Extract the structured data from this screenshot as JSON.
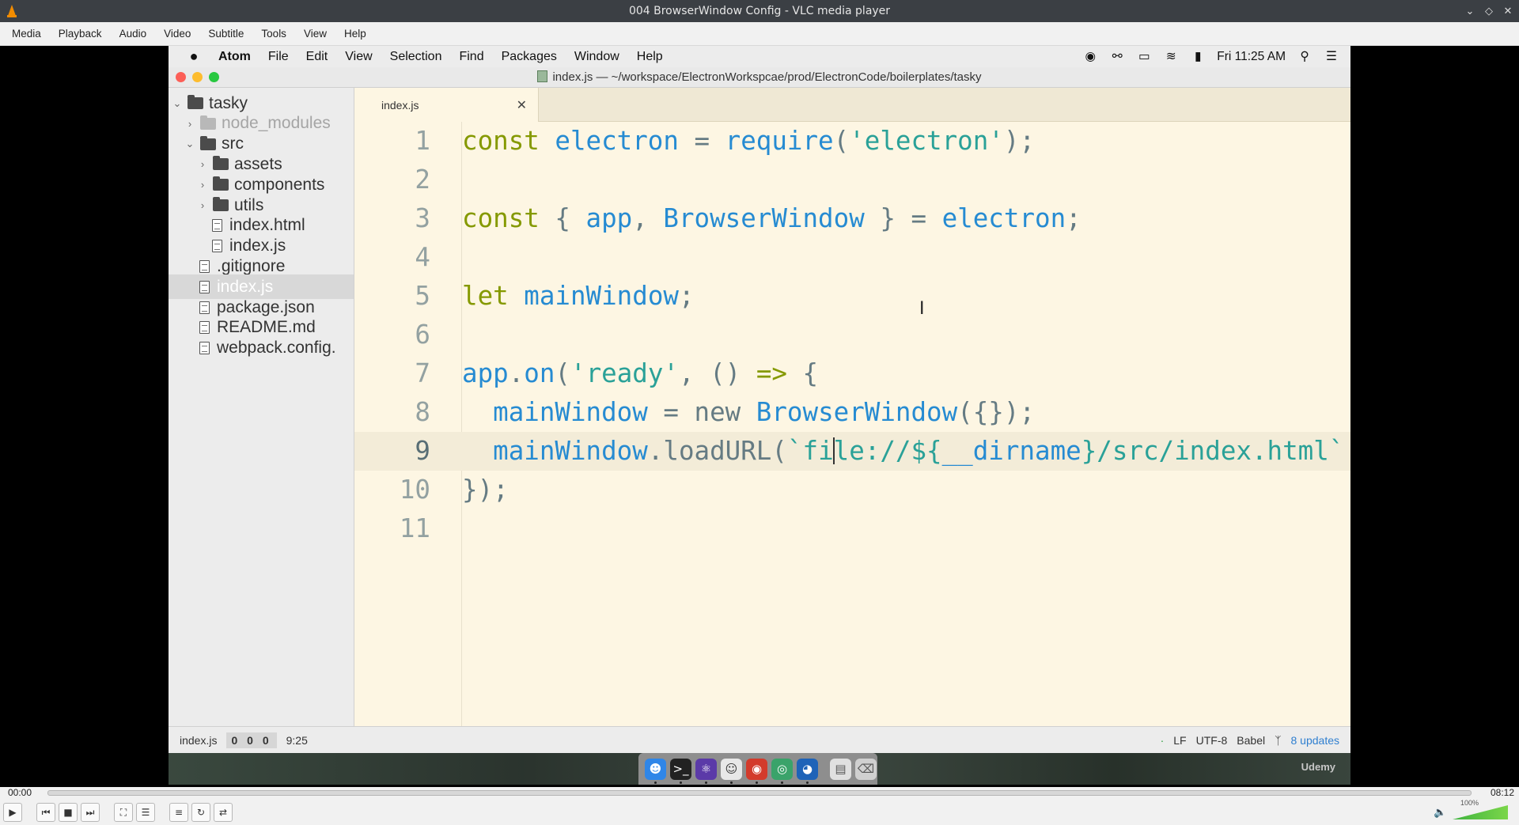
{
  "vlc": {
    "title": "004 BrowserWindow Config - VLC media player",
    "menu": [
      "Media",
      "Playback",
      "Audio",
      "Video",
      "Subtitle",
      "Tools",
      "View",
      "Help"
    ],
    "time_elapsed": "00:00",
    "time_total": "08:12",
    "volume": "100%",
    "progress": 0.0
  },
  "mac": {
    "app_name": "Atom",
    "menu": [
      "File",
      "Edit",
      "View",
      "Selection",
      "Find",
      "Packages",
      "Window",
      "Help"
    ],
    "clock": "Fri 11:25 AM"
  },
  "atom": {
    "title": "index.js — ~/workspace/ElectronWorkspcae/prod/ElectronCode/boilerplates/tasky",
    "tab_label": "index.js",
    "tree": [
      {
        "label": "tasky",
        "kind": "folder",
        "state": "open"
      },
      {
        "label": "node_modules",
        "kind": "folder",
        "state": "closed",
        "dim": true
      },
      {
        "label": "src",
        "kind": "folder",
        "state": "open"
      },
      {
        "label": "assets",
        "kind": "folder",
        "state": "closed"
      },
      {
        "label": "components",
        "kind": "folder",
        "state": "closed"
      },
      {
        "label": "utils",
        "kind": "folder",
        "state": "closed"
      },
      {
        "label": "index.html",
        "kind": "file"
      },
      {
        "label": "index.js",
        "kind": "file"
      },
      {
        "label": ".gitignore",
        "kind": "file"
      },
      {
        "label": "index.js",
        "kind": "file",
        "selected": true
      },
      {
        "label": "package.json",
        "kind": "file"
      },
      {
        "label": "README.md",
        "kind": "file"
      },
      {
        "label": "webpack.config.",
        "kind": "file"
      }
    ],
    "lines": [
      [
        [
          "kw",
          "const "
        ],
        [
          "id",
          "electron"
        ],
        [
          "op",
          " = "
        ],
        [
          "id",
          "require"
        ],
        [
          "op",
          "("
        ],
        [
          "str",
          "'electron'"
        ],
        [
          "op",
          ");"
        ]
      ],
      [],
      [
        [
          "kw",
          "const "
        ],
        [
          "op",
          "{ "
        ],
        [
          "id",
          "app"
        ],
        [
          "op",
          ", "
        ],
        [
          "id",
          "BrowserWindow"
        ],
        [
          "op",
          " } = "
        ],
        [
          "id",
          "electron"
        ],
        [
          "op",
          ";"
        ]
      ],
      [],
      [
        [
          "kw",
          "let "
        ],
        [
          "id",
          "mainWindow"
        ],
        [
          "op",
          ";"
        ]
      ],
      [],
      [
        [
          "id",
          "app"
        ],
        [
          "op",
          "."
        ],
        [
          "id",
          "on"
        ],
        [
          "op",
          "("
        ],
        [
          "str",
          "'ready'"
        ],
        [
          "op",
          ", () "
        ],
        [
          "kw",
          "=>"
        ],
        [
          "op",
          " {"
        ]
      ],
      [
        [
          "pl",
          "  "
        ],
        [
          "id",
          "mainWindow"
        ],
        [
          "op",
          " = "
        ],
        [
          "pl",
          "new "
        ],
        [
          "id",
          "BrowserWindow"
        ],
        [
          "op",
          "({});"
        ]
      ],
      [
        [
          "pl",
          "  "
        ],
        [
          "id",
          "mainWindow"
        ],
        [
          "op",
          "."
        ],
        [
          "pl",
          "loadURL("
        ],
        [
          "str",
          "`fi"
        ],
        [
          "cursor",
          ""
        ],
        [
          "str",
          "le://${"
        ],
        [
          "id",
          "__dirname"
        ],
        [
          "str",
          "}/src/index.html`"
        ]
      ],
      [
        [
          "op",
          "});"
        ]
      ],
      []
    ],
    "line_numbers": [
      "1",
      "2",
      "3",
      "4",
      "5",
      "6",
      "7",
      "8",
      "9",
      "10",
      "11"
    ],
    "current_line": 9,
    "status": {
      "file": "index.js",
      "counts": "0 0 0",
      "position": "9:25",
      "line_ending": "LF",
      "encoding": "UTF-8",
      "grammar": "Babel",
      "updates": "8 updates"
    }
  },
  "watermark": "Udemy",
  "colors": {
    "keyword": "#859900",
    "identifier": "#268bd2",
    "string": "#2aa198",
    "plain": "#657b83",
    "editor_bg": "#fdf6e3"
  }
}
